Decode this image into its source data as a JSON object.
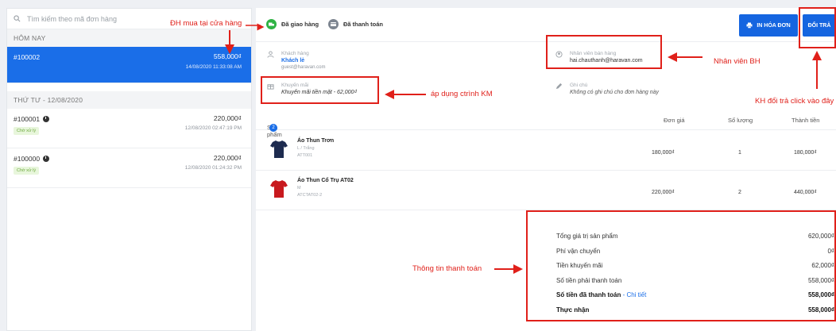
{
  "search": {
    "placeholder": "Tìm kiếm theo mã đơn hàng"
  },
  "groups": {
    "today": "HÔM NAY",
    "wednesday": "THỨ TƯ - 12/08/2020"
  },
  "orders": [
    {
      "code": "#100002",
      "amount": "558,000₫",
      "date": "14/08/2020 11:33:08 AM"
    },
    {
      "code": "#100001",
      "amount": "220,000₫",
      "date": "12/08/2020 02:47:19 PM",
      "badge": "Chờ xử lý"
    },
    {
      "code": "#100000",
      "amount": "220,000₫",
      "date": "12/08/2020 01:24:32 PM",
      "badge": "Chờ xử lý"
    }
  ],
  "status": {
    "delivered": "Đã giao hàng",
    "paid": "Đã thanh toán"
  },
  "buttons": {
    "print": "IN HÓA ĐƠN",
    "return": "ĐỔI TRẢ"
  },
  "customer": {
    "label": "Khách hàng",
    "name": "Khách lẻ",
    "email": "guest@haravan.com"
  },
  "staff": {
    "label": "Nhân viên bán hàng",
    "email": "hai.chauthanh@haravan.com"
  },
  "promo": {
    "label": "Khuyến mãi",
    "value": "Khuyến mãi tiền mặt - 62,000₫"
  },
  "note": {
    "label": "Ghi chú",
    "value": "Không có ghi chú cho đơn hàng này"
  },
  "products": {
    "headers": {
      "product": "Sản phẩm",
      "count": "2",
      "price": "Đơn giá",
      "qty": "Số lượng",
      "total": "Thành tiền"
    },
    "items": [
      {
        "name": "Áo Thun Trơn",
        "variant": "L / Trắng",
        "sku": "ATT001",
        "price": "180,000₫",
        "qty": "1",
        "total": "180,000₫",
        "color": "#1d2b4f"
      },
      {
        "name": "Áo Thun Cổ Trụ AT02",
        "variant": "M",
        "sku": "ATCTAT02-2",
        "price": "220,000₫",
        "qty": "2",
        "total": "440,000₫",
        "color": "#c8191e"
      }
    ]
  },
  "summary": {
    "subtotal_label": "Tổng giá trị sản phẩm",
    "subtotal": "620,000₫",
    "shipping_label": "Phí vận chuyển",
    "shipping": "0₫",
    "discount_label": "Tiền khuyến mãi",
    "discount": "62,000₫",
    "due_label": "Số tiền phải thanh toán",
    "due": "558,000₫",
    "paid_label": "Số tiền đã thanh toán",
    "paid_link": "Chi tiết",
    "paid_sep": " - ",
    "paid": "558,000₫",
    "received_label": "Thực nhận",
    "received": "558,000₫"
  },
  "annotations": {
    "store_purchase": "ĐH mua tại cửa hàng",
    "staff": "Nhân viên BH",
    "promo": "áp dụng ctrình KM",
    "return": "KH đổi trả click vào đây",
    "payment": "Thông tin thanh toán"
  },
  "colors": {
    "primary": "#1a6ee8",
    "delivered": "#2fb344",
    "annotation": "#e0201a"
  }
}
